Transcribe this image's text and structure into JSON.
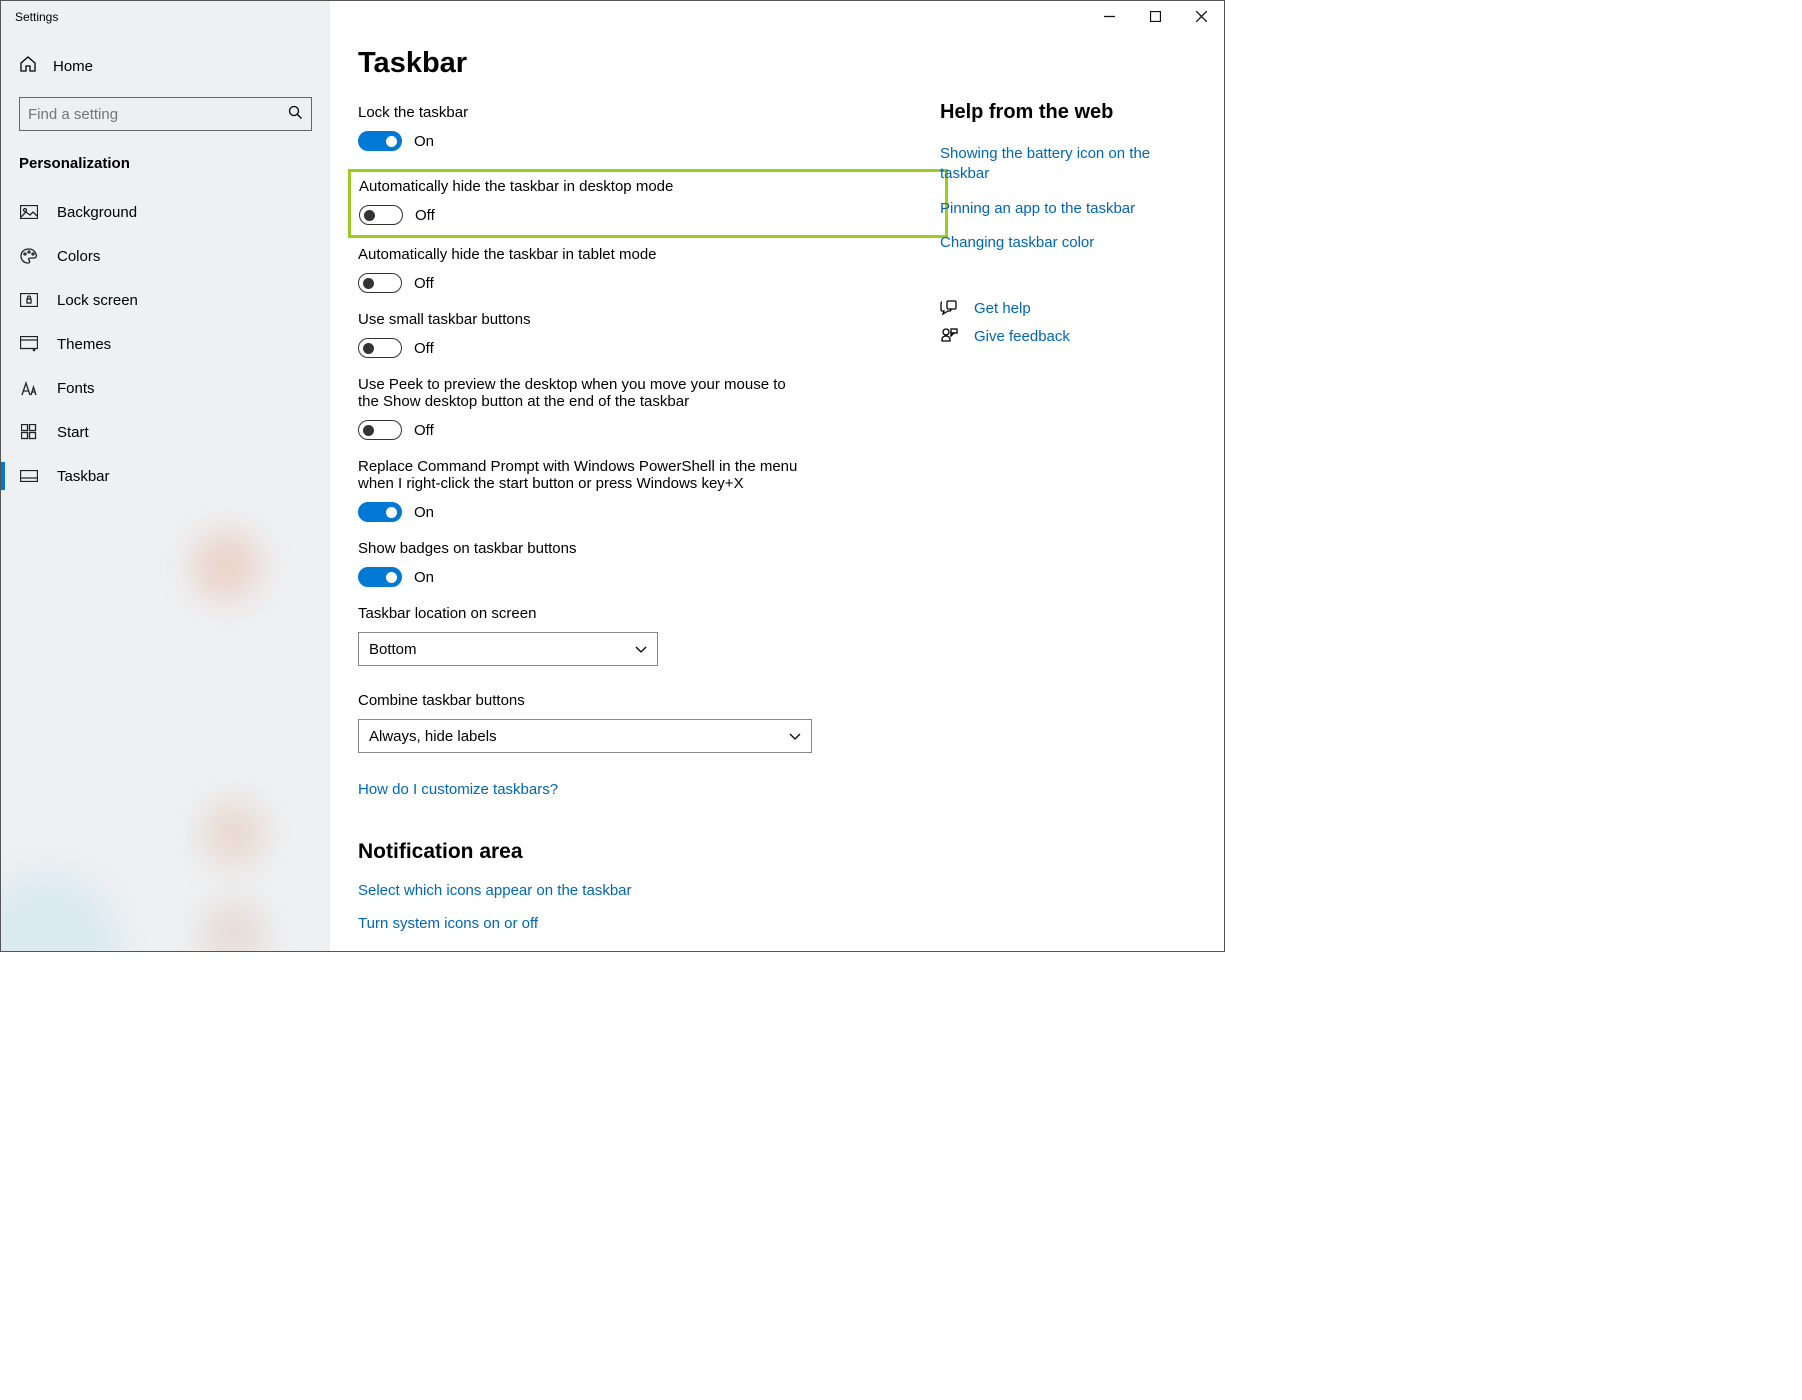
{
  "window": {
    "title": "Settings"
  },
  "sidebar": {
    "home_label": "Home",
    "search_placeholder": "Find a setting",
    "section_label": "Personalization",
    "items": [
      {
        "label": "Background"
      },
      {
        "label": "Colors"
      },
      {
        "label": "Lock screen"
      },
      {
        "label": "Themes"
      },
      {
        "label": "Fonts"
      },
      {
        "label": "Start"
      },
      {
        "label": "Taskbar"
      }
    ]
  },
  "page": {
    "title": "Taskbar",
    "settings": {
      "lock": {
        "label": "Lock the taskbar",
        "state": "On"
      },
      "autohide_desktop": {
        "label": "Automatically hide the taskbar in desktop mode",
        "state": "Off"
      },
      "autohide_tablet": {
        "label": "Automatically hide the taskbar in tablet mode",
        "state": "Off"
      },
      "small_buttons": {
        "label": "Use small taskbar buttons",
        "state": "Off"
      },
      "peek": {
        "label": "Use Peek to preview the desktop when you move your mouse to the Show desktop button at the end of the taskbar",
        "state": "Off"
      },
      "powershell": {
        "label": "Replace Command Prompt with Windows PowerShell in the menu when I right-click the start button or press Windows key+X",
        "state": "On"
      },
      "badges": {
        "label": "Show badges on taskbar buttons",
        "state": "On"
      },
      "location": {
        "label": "Taskbar location on screen",
        "value": "Bottom"
      },
      "combine": {
        "label": "Combine taskbar buttons",
        "value": "Always, hide labels"
      }
    },
    "customize_link": "How do I customize taskbars?",
    "notification_heading": "Notification area",
    "notification_links": {
      "select_icons": "Select which icons appear on the taskbar",
      "system_icons": "Turn system icons on or off"
    }
  },
  "help": {
    "heading": "Help from the web",
    "links": [
      "Showing the battery icon on the taskbar",
      "Pinning an app to the taskbar",
      "Changing taskbar color"
    ],
    "get_help": "Get help",
    "feedback": "Give feedback"
  }
}
